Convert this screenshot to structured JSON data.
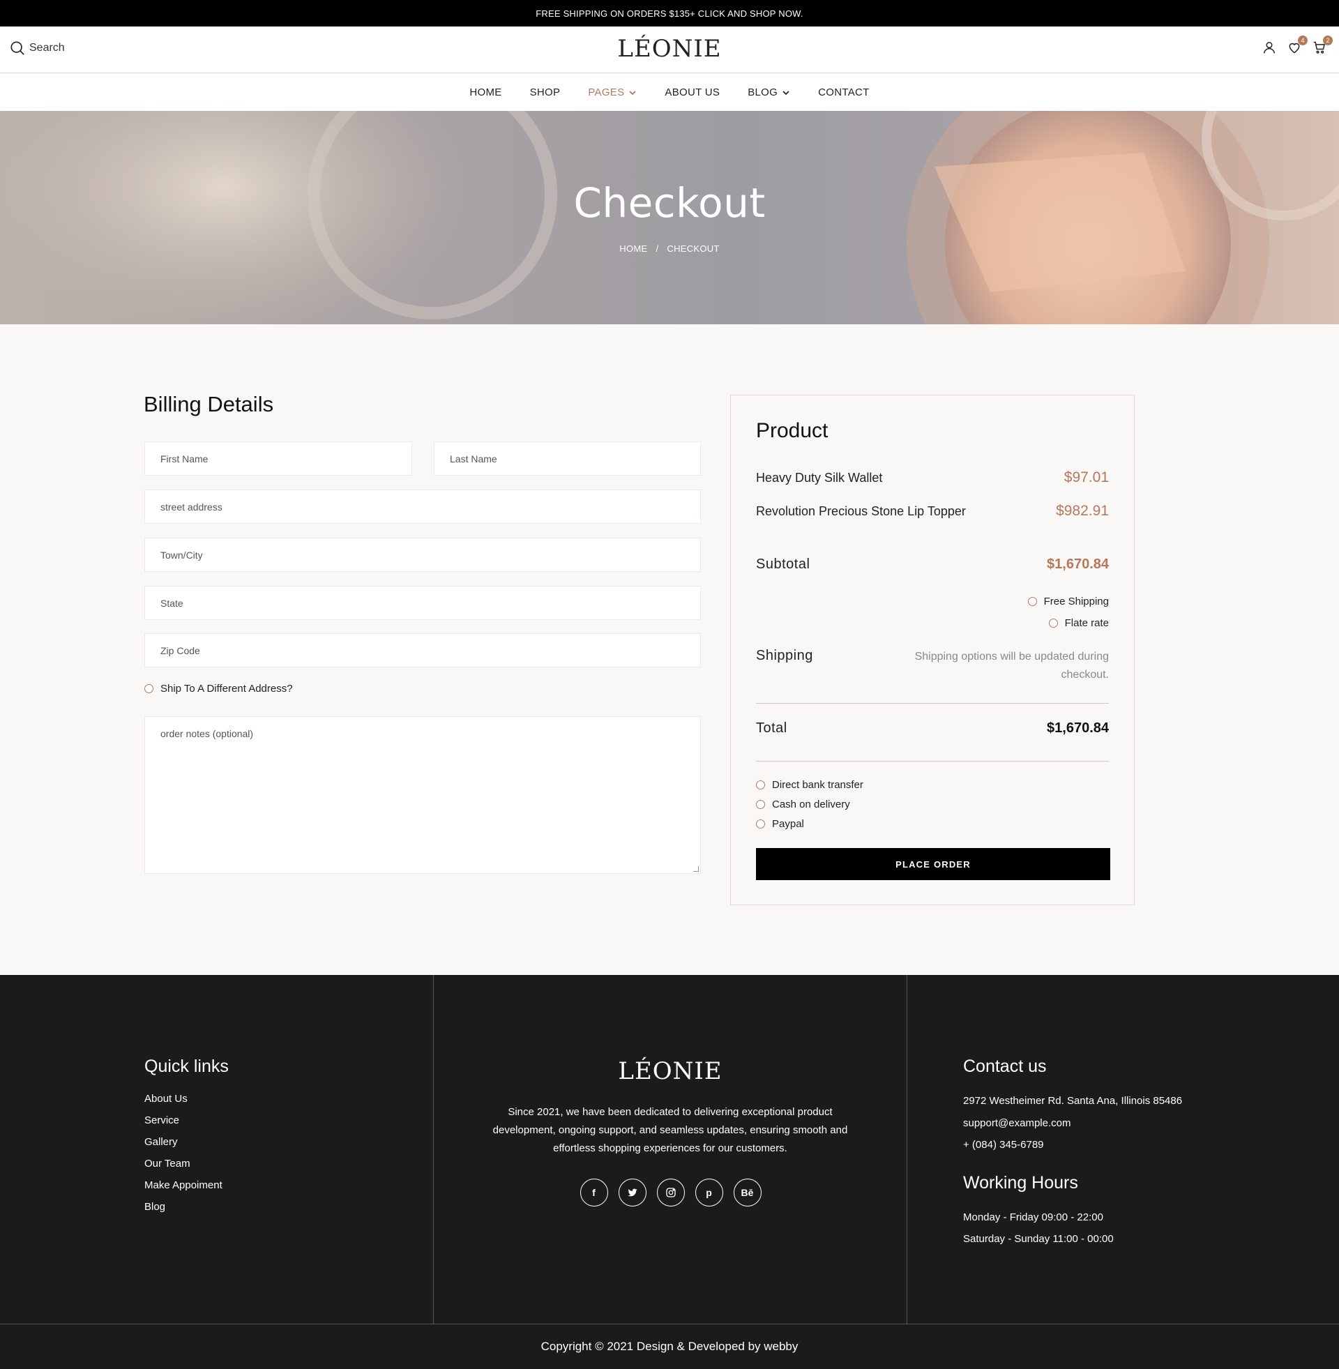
{
  "announcement": "FREE SHIPPING ON ORDERS $135+ CLICK AND SHOP NOW.",
  "header": {
    "search_label": "Search",
    "logo": "LÉONIE",
    "wishlist_count": "4",
    "cart_count": "2"
  },
  "nav": {
    "items": [
      {
        "label": "HOME"
      },
      {
        "label": "SHOP"
      },
      {
        "label": "PAGES"
      },
      {
        "label": "ABOUT US"
      },
      {
        "label": "BLOG"
      },
      {
        "label": "CONTACT"
      }
    ]
  },
  "hero": {
    "title": "Checkout",
    "breadcrumb_home": "HOME",
    "breadcrumb_sep": "/",
    "breadcrumb_current": "CHECKOUT"
  },
  "billing": {
    "title": "Billing Details",
    "first_name": "First Name",
    "last_name": "Last Name",
    "street": "street address",
    "town": "Town/City",
    "state": "State",
    "zip": "Zip Code",
    "ship_different": "Ship To A Different Address?",
    "notes": "order notes (optional)"
  },
  "order": {
    "title": "Product",
    "items": [
      {
        "name": "Heavy Duty Silk Wallet",
        "price": "$97.01"
      },
      {
        "name": "Revolution Precious Stone Lip Topper",
        "price": "$982.91"
      }
    ],
    "subtotal_label": "Subtotal",
    "subtotal_value": "$1,670.84",
    "shipping_options": [
      "Free Shipping",
      "Flate rate"
    ],
    "shipping_label": "Shipping",
    "shipping_note": "Shipping options will be updated during checkout.",
    "total_label": "Total",
    "total_value": "$1,670.84",
    "payment_methods": [
      "Direct bank transfer",
      "Cash on delivery",
      "Paypal"
    ],
    "place_order": "PLACE ORDER"
  },
  "footer": {
    "quick_links_title": "Quick links",
    "quick_links": [
      "About Us",
      "Service",
      "Gallery",
      "Our Team",
      "Make Appoiment",
      "Blog"
    ],
    "logo": "LÉONIE",
    "about": "Since 2021, we have been dedicated to delivering exceptional product development, ongoing support, and seamless updates, ensuring smooth and effortless shopping experiences for our customers.",
    "social": [
      {
        "icon": "facebook-icon",
        "glyph": "f"
      },
      {
        "icon": "twitter-icon",
        "glyph": "t"
      },
      {
        "icon": "instagram-icon",
        "glyph": "◎"
      },
      {
        "icon": "pinterest-icon",
        "glyph": "p"
      },
      {
        "icon": "behance-icon",
        "glyph": "Bē"
      }
    ],
    "contact_title": "Contact us",
    "address": "2972 Westheimer Rd. Santa Ana, Illinois 85486",
    "email": "support@example.com",
    "phone": "+ (084) 345-6789",
    "hours_title": "Working Hours",
    "hours_weekday": "Monday - Friday 09:00 - 22:00",
    "hours_weekend": "Saturday - Sunday 11:00 - 00:00",
    "copyright": "Copyright © 2021 Design & Developed by webby"
  },
  "colors": {
    "accent": "#b7785a",
    "dark": "#1b1b1b",
    "background": "#faf8f6"
  }
}
